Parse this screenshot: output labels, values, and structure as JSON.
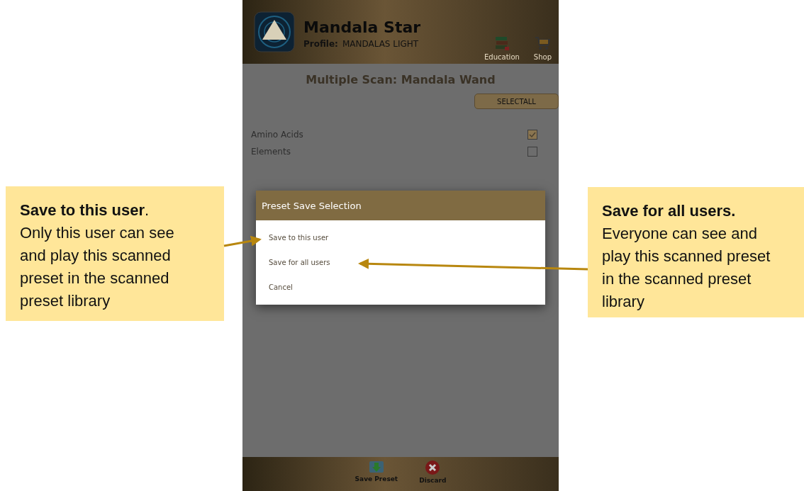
{
  "app": {
    "title": "Mandala Star",
    "profile_label": "Profile:",
    "profile": "MANDALAS LIGHT",
    "nav": [
      {
        "kind": "education",
        "label": "Education"
      },
      {
        "kind": "shop",
        "label": "Shop"
      }
    ]
  },
  "screen": {
    "title": "Multiple Scan: Mandala Wand",
    "select_all": "SELECTALL",
    "items": [
      {
        "label": "Amino Acids",
        "checked": true
      },
      {
        "label": "Elements",
        "checked": false
      }
    ]
  },
  "dialog": {
    "title": "Preset Save Selection",
    "options": [
      "Save to this user",
      "Save for all users",
      "Cancel"
    ]
  },
  "footer": [
    {
      "kind": "save",
      "label": "Save Preset"
    },
    {
      "kind": "discard",
      "label": "Discard"
    }
  ],
  "callouts": [
    {
      "title": "**Save to this user**.",
      "body": "Only this user can see and play this scanned preset in the scanned preset library"
    },
    {
      "title": "**Save for all users.**",
      "body": "Everyone can see and play this scanned preset in the scanned preset library"
    }
  ]
}
